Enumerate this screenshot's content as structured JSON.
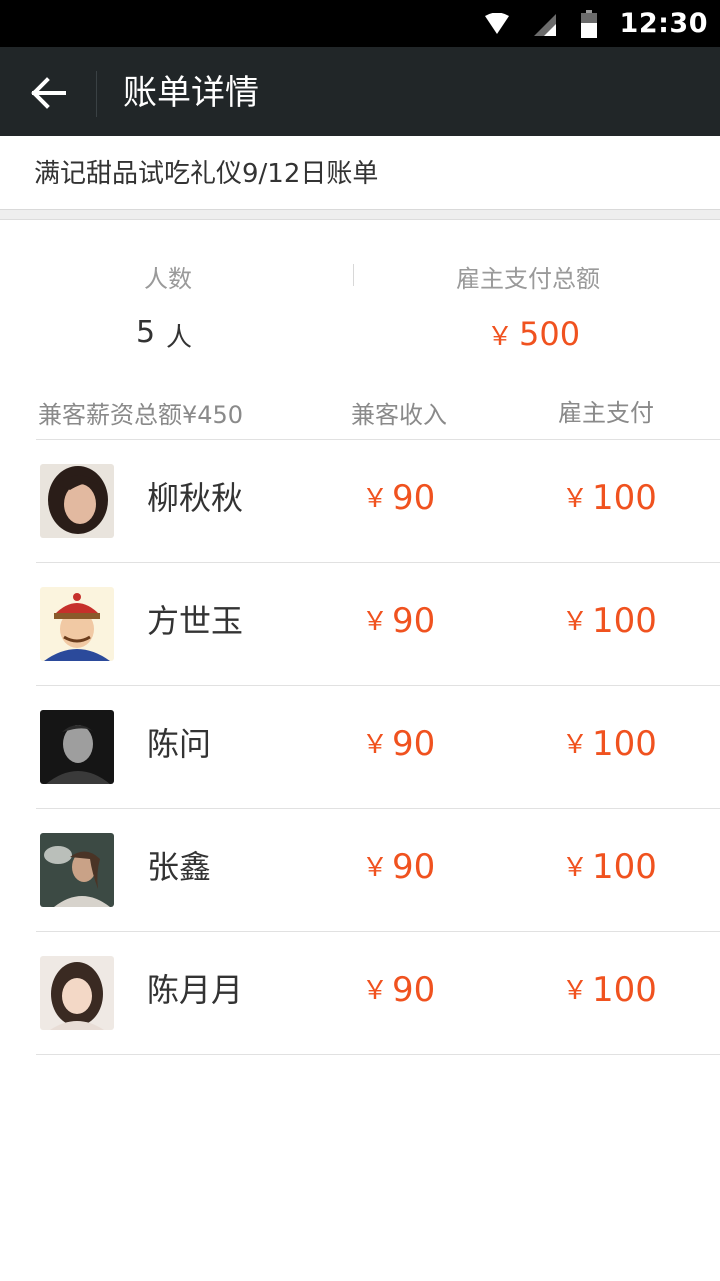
{
  "status_bar": {
    "time": "12:30",
    "icons": [
      "wifi-icon",
      "signal-icon",
      "battery-icon"
    ]
  },
  "header": {
    "title": "账单详情",
    "back_icon": "arrow-left-icon"
  },
  "bill": {
    "title": "满记甜品试吃礼仪9/12日账单"
  },
  "summary": {
    "headcount_label": "人数",
    "headcount_value": "5",
    "headcount_unit": "人",
    "employer_total_label": "雇主支付总额",
    "employer_total_currency": "￥",
    "employer_total_value": "500"
  },
  "columns": {
    "wage_total": "兼客薪资总额¥450",
    "worker_income": "兼客收入",
    "employer_pay": "雇主支付"
  },
  "workers": [
    {
      "name": "柳秋秋",
      "currency": "￥",
      "income": "90",
      "pay": "100"
    },
    {
      "name": "方世玉",
      "currency": "￥",
      "income": "90",
      "pay": "100"
    },
    {
      "name": "陈问",
      "currency": "￥",
      "income": "90",
      "pay": "100"
    },
    {
      "name": "张鑫",
      "currency": "￥",
      "income": "90",
      "pay": "100"
    },
    {
      "name": "陈月月",
      "currency": "￥",
      "income": "90",
      "pay": "100"
    }
  ],
  "colors": {
    "app_bar": "#212628",
    "accent_amount": "#f0521f",
    "status_bar": "#000000"
  }
}
